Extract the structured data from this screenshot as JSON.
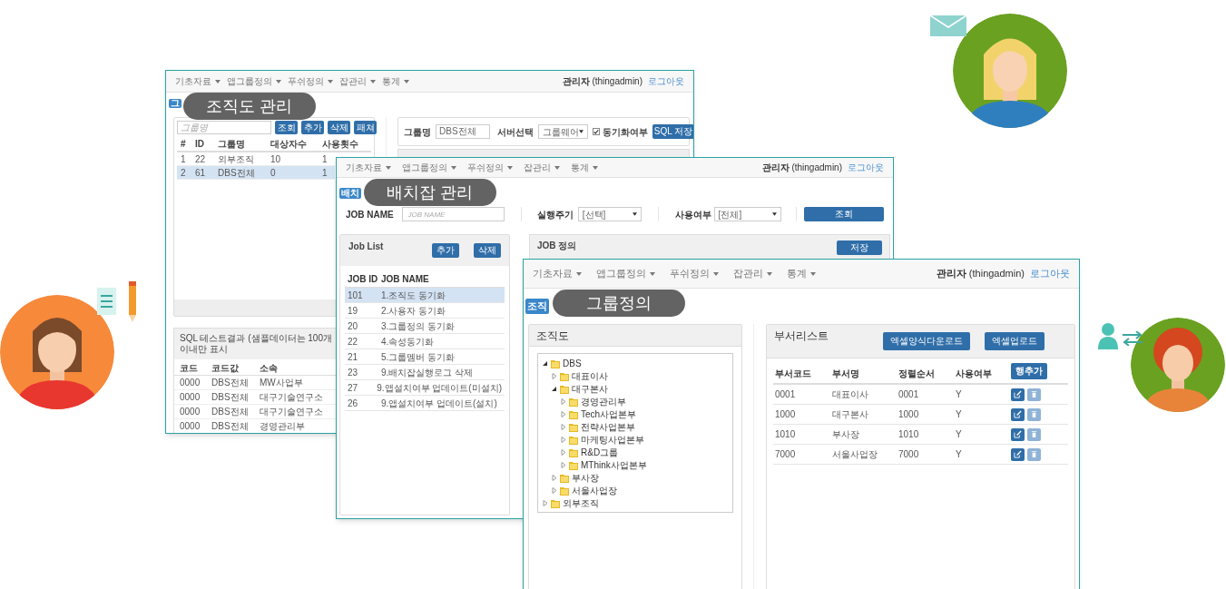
{
  "windows": [
    {
      "kind": "org_chart_admin",
      "caption": "조직도 관리",
      "tab": "그",
      "nav": {
        "menus": [
          "기초자료",
          "앱그룹정의",
          "푸쉬정의",
          "잡관리",
          "통계"
        ],
        "user": "**관리자** (thingadmin)",
        "logout": "로그아웃"
      },
      "group_search": {
        "placeholder": "그룹명",
        "buttons": [
          "조회",
          "추가",
          "삭제",
          "패쳐"
        ]
      },
      "group_table": {
        "columns": [
          "#",
          "ID",
          "그룹명",
          "대상자수",
          "사용횟수"
        ],
        "rows": [
          {
            "cells": [
              "1",
              "22",
              "외부조직",
              "10",
              "1"
            ],
            "selected": false
          },
          {
            "cells": [
              "2",
              "61",
              "DBS전체",
              "0",
              "1"
            ],
            "selected": true
          }
        ]
      },
      "form": {
        "group_label": "그룹명",
        "group_value": "DBS전체",
        "server_label": "서버선택",
        "server_value": "그룹웨어",
        "sync": {
          "label": "동기화여부",
          "checked": true
        },
        "save": "SQL 저장"
      },
      "sql_result": {
        "title": "SQL 테스트결과  (샘플데이터는 100개이내만 표시",
        "columns": [
          "코드",
          "코드값",
          "소속"
        ],
        "rows": [
          [
            "0000",
            "DBS전체",
            "MW사업부"
          ],
          [
            "0000",
            "DBS전체",
            "대구기술연구소"
          ],
          [
            "0000",
            "DBS전체",
            "대구기술연구소"
          ],
          [
            "0000",
            "DBS전체",
            "경영관리부"
          ]
        ]
      }
    },
    {
      "kind": "batch_job_admin",
      "caption": "배치잡 관리",
      "tab": "배치",
      "nav": {
        "menus": [
          "기초자료",
          "앱그룹정의",
          "푸쉬정의",
          "잡관리",
          "통계"
        ],
        "user": "**관리자** (thingadmin)",
        "logout": "로그아웃"
      },
      "filters": {
        "job_name_label": "JOB NAME",
        "job_name_placeholder": "JOB NAME",
        "cycle_label": "실행주기",
        "cycle_value": "[선택]",
        "use_label": "사용여부",
        "use_value": "[전체]",
        "search": "조회"
      },
      "job_list": {
        "title": "Job List",
        "buttons": [
          "추가",
          "삭제"
        ],
        "columns": [
          "JOB ID",
          "JOB NAME"
        ],
        "rows": [
          {
            "cells": [
              "101",
              "1.조직도 동기화"
            ],
            "selected": true
          },
          {
            "cells": [
              "19",
              "2.사용자 동기화"
            ],
            "selected": false
          },
          {
            "cells": [
              "20",
              "3.그룹정의 동기화"
            ],
            "selected": false
          },
          {
            "cells": [
              "22",
              "4.속성동기화"
            ],
            "selected": false
          },
          {
            "cells": [
              "21",
              "5.그룹멤버 동기화"
            ],
            "selected": false
          },
          {
            "cells": [
              "23",
              "9.배치잡실행로그 삭제"
            ],
            "selected": false
          },
          {
            "cells": [
              "27",
              "9.앱설치여부 업데이트(미설치)"
            ],
            "selected": false
          },
          {
            "cells": [
              "26",
              "9.앱설치여부 업데이트(설치)"
            ],
            "selected": false
          }
        ]
      },
      "job_def": {
        "title": "JOB 정의",
        "save": "저장"
      }
    },
    {
      "kind": "group_definition",
      "caption": "그룹정의",
      "tab": "조직",
      "nav": {
        "menus": [
          "기초자료",
          "앱그룹정의",
          "푸쉬정의",
          "잡관리",
          "통계"
        ],
        "user": "**관리자** (thingadmin)",
        "logout": "로그아웃"
      },
      "org_tree": {
        "title": "조직도",
        "nodes": [
          {
            "label": "DBS",
            "expanded": true,
            "children": [
              {
                "label": "대표이사",
                "expanded": false
              },
              {
                "label": "대구본사",
                "expanded": true,
                "children": [
                  {
                    "label": "경영관리부",
                    "expanded": false
                  },
                  {
                    "label": "Tech사업본부",
                    "expanded": false
                  },
                  {
                    "label": "전략사업본부",
                    "expanded": false
                  },
                  {
                    "label": "마케팅사업본부",
                    "expanded": false
                  },
                  {
                    "label": "R&D그룹",
                    "expanded": false
                  },
                  {
                    "label": "MThink사업본부",
                    "expanded": false
                  }
                ]
              },
              {
                "label": "부사장",
                "expanded": false
              },
              {
                "label": "서울사업장",
                "expanded": false
              }
            ]
          },
          {
            "label": "외부조직",
            "expanded": false
          }
        ]
      },
      "dept_list": {
        "title": "부서리스트",
        "buttons": [
          "엑셀양식다운로드",
          "엑셀업로드"
        ],
        "columns": [
          "부서코드",
          "부서명",
          "정렬순서",
          "사용여부"
        ],
        "add_row": "행추가",
        "rows": [
          [
            "0001",
            "대표이사",
            "0001",
            "Y"
          ],
          [
            "1000",
            "대구본사",
            "1000",
            "Y"
          ],
          [
            "1010",
            "부사장",
            "1010",
            "Y"
          ],
          [
            "7000",
            "서울사업장",
            "7000",
            "Y"
          ]
        ]
      }
    }
  ]
}
